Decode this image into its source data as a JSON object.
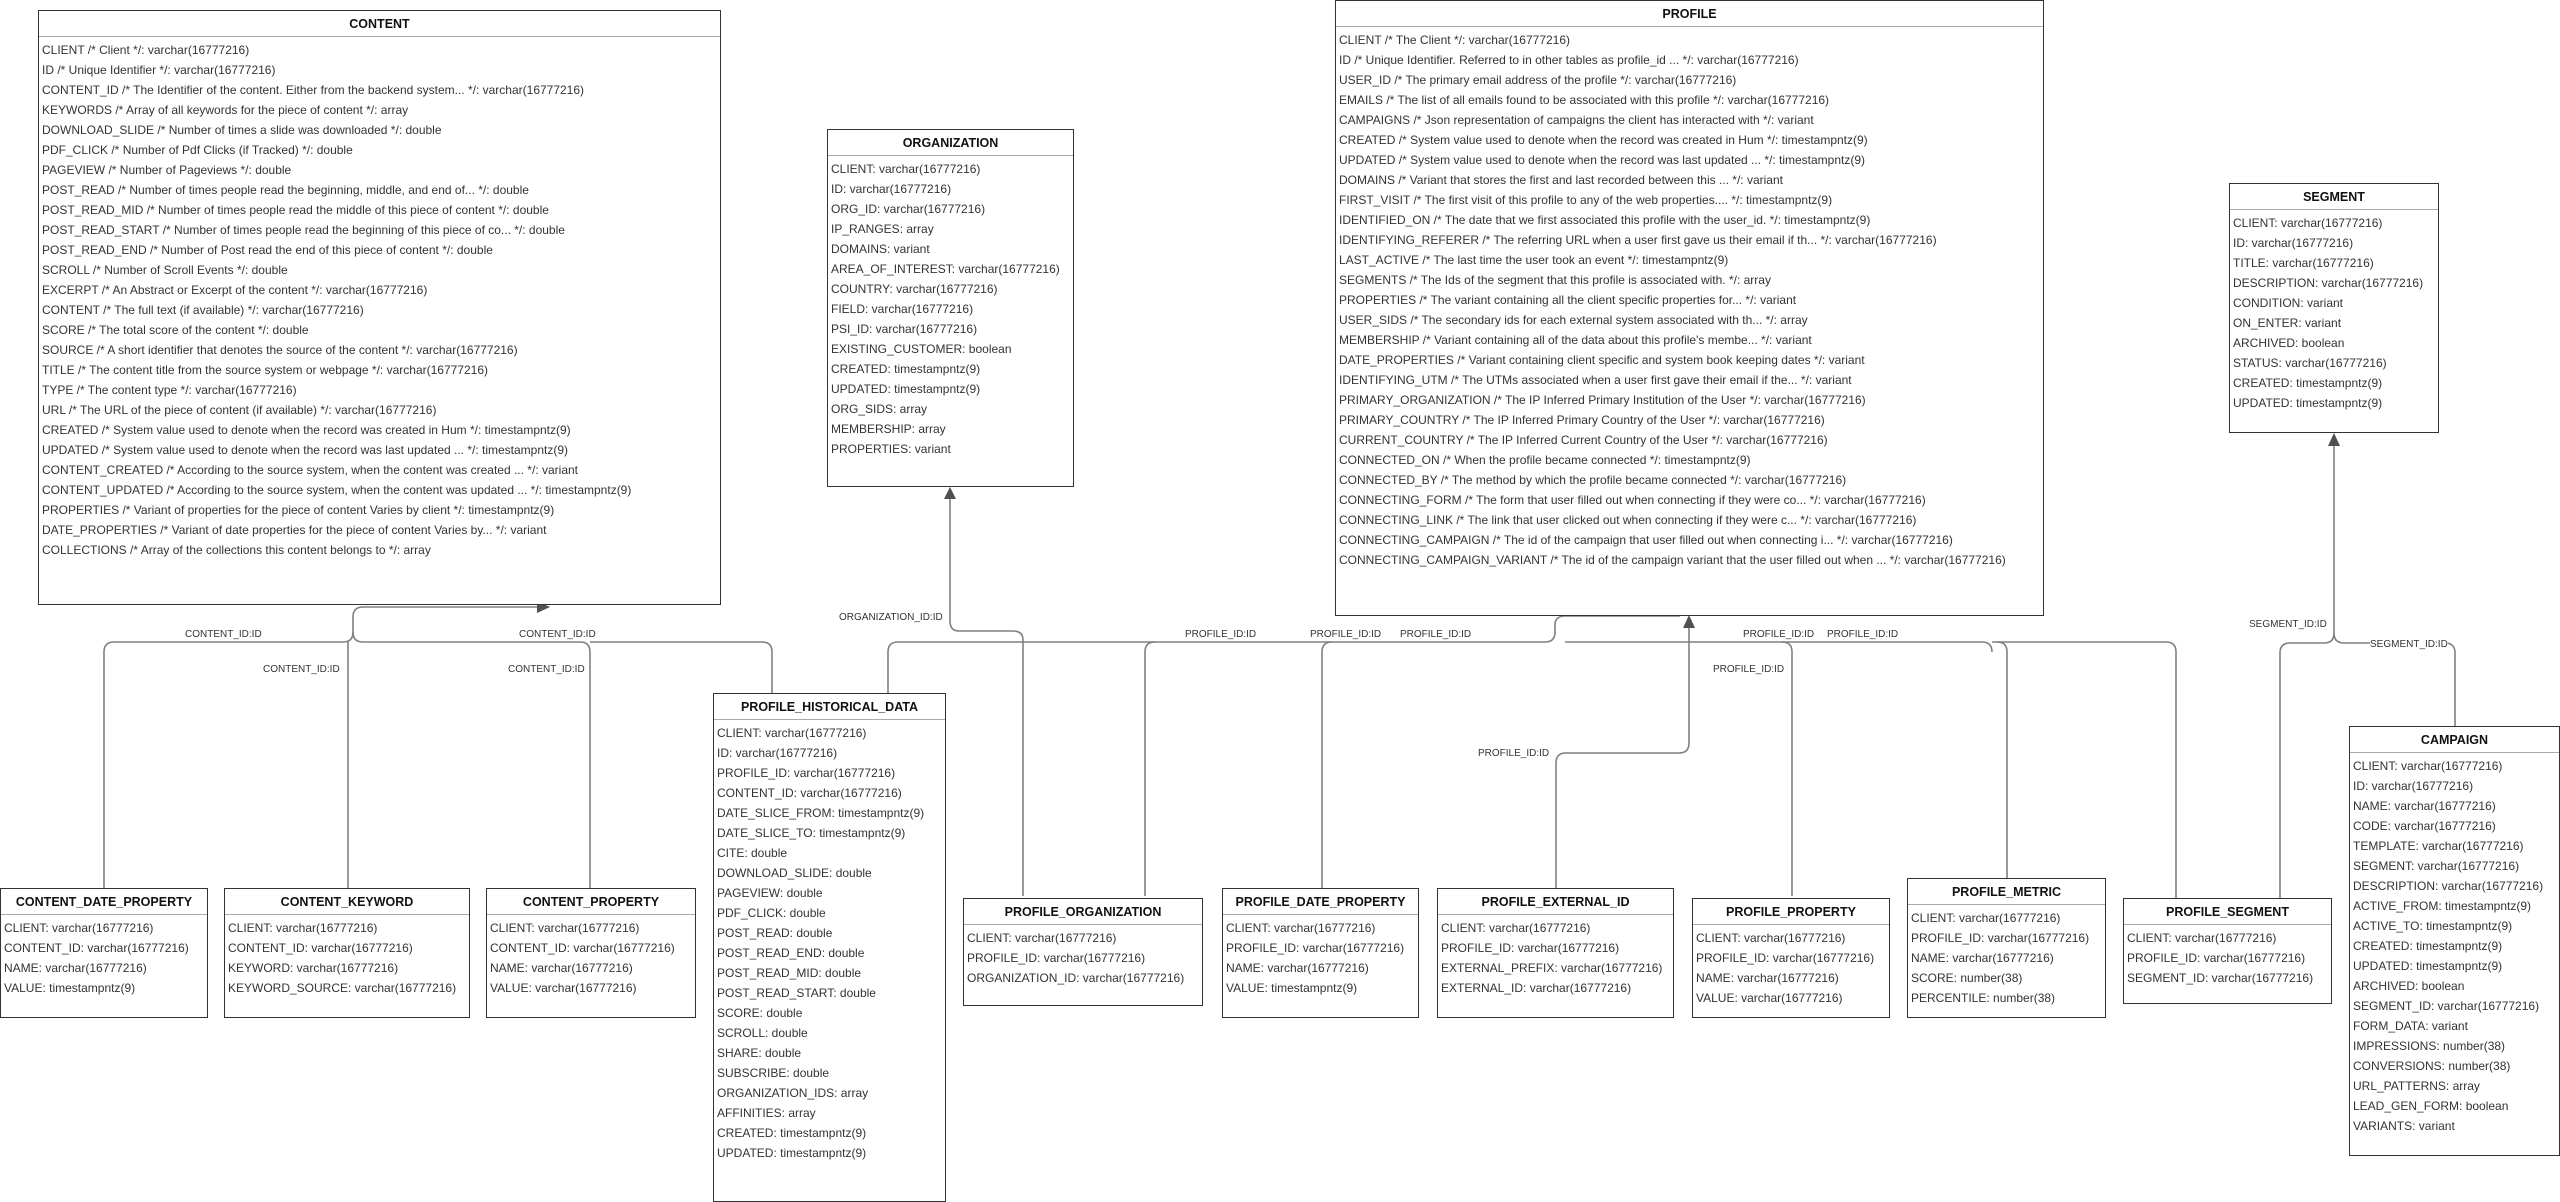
{
  "diagram": {
    "entities": {
      "content": {
        "title": "CONTENT",
        "fields": [
          "CLIENT /* Client */: varchar(16777216)",
          "ID /* Unique Identifier */: varchar(16777216)",
          "CONTENT_ID /* The Identifier of the content. Either from the backend system... */: varchar(16777216)",
          "KEYWORDS /* Array of all keywords for the piece of content */: array",
          "DOWNLOAD_SLIDE /* Number of times a slide was downloaded */: double",
          "PDF_CLICK /* Number of Pdf Clicks (if Tracked) */: double",
          "PAGEVIEW /* Number of Pageviews */: double",
          "POST_READ /* Number of times people read the beginning, middle, and end of... */: double",
          "POST_READ_MID /* Number of times people read the middle of this piece of content */: double",
          "POST_READ_START /* Number of times people read the beginning of this piece of co... */: double",
          "POST_READ_END /* Number of Post read the end of this piece of content */: double",
          "SCROLL /* Number of Scroll Events */: double",
          "EXCERPT /* An Abstract or Excerpt of the content */: varchar(16777216)",
          "CONTENT /* The full text (if available) */: varchar(16777216)",
          "SCORE /* The total score of the content */: double",
          "SOURCE /* A short identifier that denotes the source of the content */: varchar(16777216)",
          "TITLE /* The content title from the source system or webpage */: varchar(16777216)",
          "TYPE /* The content type */: varchar(16777216)",
          "URL /* The URL of the piece of content (if available) */: varchar(16777216)",
          "CREATED /* System value used to denote when the record was created in Hum */: timestampntz(9)",
          "UPDATED /* System value used to denote when the record was last updated ... */: timestampntz(9)",
          "CONTENT_CREATED /* According to the source system, when the content was created ... */: variant",
          "CONTENT_UPDATED /* According to the source system, when the content was updated ... */: timestampntz(9)",
          "PROPERTIES /* Variant of properties for the piece of content Varies by client */: timestampntz(9)",
          "DATE_PROPERTIES /* Variant of date properties for the piece of content Varies by... */: variant",
          "COLLECTIONS /* Array of the collections this content belongs to */: array"
        ]
      },
      "organization": {
        "title": "ORGANIZATION",
        "fields": [
          "CLIENT: varchar(16777216)",
          "ID: varchar(16777216)",
          "ORG_ID: varchar(16777216)",
          "IP_RANGES: array",
          "DOMAINS: variant",
          "AREA_OF_INTEREST: varchar(16777216)",
          "COUNTRY: varchar(16777216)",
          "FIELD: varchar(16777216)",
          "PSI_ID: varchar(16777216)",
          "EXISTING_CUSTOMER: boolean",
          "CREATED: timestampntz(9)",
          "UPDATED: timestampntz(9)",
          "ORG_SIDS: array",
          "MEMBERSHIP: array",
          "PROPERTIES: variant"
        ]
      },
      "profile": {
        "title": "PROFILE",
        "fields": [
          "CLIENT /* The Client */: varchar(16777216)",
          "ID /* Unique Identifier. Referred to in other tables as profile_id ... */: varchar(16777216)",
          "USER_ID /* The primary email address of the profile */: varchar(16777216)",
          "EMAILS /* The list of all emails found to be associated with this profile */: varchar(16777216)",
          "CAMPAIGNS /* Json representation of campaigns the client has interacted with */: variant",
          "CREATED /* System value used to denote when the record was created in Hum */: timestampntz(9)",
          "UPDATED /* System value used to denote when the record was last updated ... */: timestampntz(9)",
          "DOMAINS /* Variant that stores the first and last recorded between this ... */: variant",
          "FIRST_VISIT /* The first visit of this profile to any of the web properties.... */: timestampntz(9)",
          "IDENTIFIED_ON /* The date that we first associated this profile with the user_id. */: timestampntz(9)",
          "IDENTIFYING_REFERER /* The referring URL when a user first gave us their email if th... */: varchar(16777216)",
          "LAST_ACTIVE /* The last time the user took an event */: timestampntz(9)",
          "SEGMENTS /* The Ids of the segment that this profile is associated with. */: array",
          "PROPERTIES /* The variant containing all the client specific properties for... */: variant",
          "USER_SIDS /* The secondary ids for each external system associated with th... */: array",
          "MEMBERSHIP /* Variant containing all of the data about this profile's membe... */: variant",
          "DATE_PROPERTIES /* Variant containing client specific and system book keeping dates */: variant",
          "IDENTIFYING_UTM /* The UTMs associated when a user first gave their email if the... */: variant",
          "PRIMARY_ORGANIZATION /* The IP Inferred Primary Institution of the User */: varchar(16777216)",
          "PRIMARY_COUNTRY /* The IP Inferred Primary Country of the User */: varchar(16777216)",
          "CURRENT_COUNTRY /* The IP Inferred Current Country of the User */: varchar(16777216)",
          "CONNECTED_ON /* When the profile became connected */: timestampntz(9)",
          "CONNECTED_BY /* The method by which the profile became connected */: varchar(16777216)",
          "CONNECTING_FORM /* The form that user filled out when connecting if they were co... */: varchar(16777216)",
          "CONNECTING_LINK /* The link that user clicked out when connecting if they were c... */: varchar(16777216)",
          "CONNECTING_CAMPAIGN /* The id of the campaign that user filled out when connecting i... */: varchar(16777216)",
          "CONNECTING_CAMPAIGN_VARIANT /* The id of the campaign variant that the user filled out when ... */: varchar(16777216)"
        ]
      },
      "segment": {
        "title": "SEGMENT",
        "fields": [
          "CLIENT: varchar(16777216)",
          "ID: varchar(16777216)",
          "TITLE: varchar(16777216)",
          "DESCRIPTION: varchar(16777216)",
          "CONDITION: variant",
          "ON_ENTER: variant",
          "ARCHIVED: boolean",
          "STATUS: varchar(16777216)",
          "CREATED: timestampntz(9)",
          "UPDATED: timestampntz(9)"
        ]
      },
      "profile_historical_data": {
        "title": "PROFILE_HISTORICAL_DATA",
        "fields": [
          "CLIENT: varchar(16777216)",
          "ID: varchar(16777216)",
          "PROFILE_ID: varchar(16777216)",
          "CONTENT_ID: varchar(16777216)",
          "DATE_SLICE_FROM: timestampntz(9)",
          "DATE_SLICE_TO: timestampntz(9)",
          "CITE: double",
          "DOWNLOAD_SLIDE: double",
          "PAGEVIEW: double",
          "PDF_CLICK: double",
          "POST_READ: double",
          "POST_READ_END: double",
          "POST_READ_MID: double",
          "POST_READ_START: double",
          "SCORE: double",
          "SCROLL: double",
          "SHARE: double",
          "SUBSCRIBE: double",
          "ORGANIZATION_IDS: array",
          "AFFINITIES: array",
          "CREATED: timestampntz(9)",
          "UPDATED: timestampntz(9)"
        ]
      },
      "content_date_property": {
        "title": "CONTENT_DATE_PROPERTY",
        "fields": [
          "CLIENT: varchar(16777216)",
          "CONTENT_ID: varchar(16777216)",
          "NAME: varchar(16777216)",
          "VALUE: timestampntz(9)"
        ]
      },
      "content_keyword": {
        "title": "CONTENT_KEYWORD",
        "fields": [
          "CLIENT: varchar(16777216)",
          "CONTENT_ID: varchar(16777216)",
          "KEYWORD: varchar(16777216)",
          "KEYWORD_SOURCE: varchar(16777216)"
        ]
      },
      "content_property": {
        "title": "CONTENT_PROPERTY",
        "fields": [
          "CLIENT: varchar(16777216)",
          "CONTENT_ID: varchar(16777216)",
          "NAME: varchar(16777216)",
          "VALUE: varchar(16777216)"
        ]
      },
      "profile_organization": {
        "title": "PROFILE_ORGANIZATION",
        "fields": [
          "CLIENT: varchar(16777216)",
          "PROFILE_ID: varchar(16777216)",
          "ORGANIZATION_ID: varchar(16777216)"
        ]
      },
      "profile_date_property": {
        "title": "PROFILE_DATE_PROPERTY",
        "fields": [
          "CLIENT: varchar(16777216)",
          "PROFILE_ID: varchar(16777216)",
          "NAME: varchar(16777216)",
          "VALUE: timestampntz(9)"
        ]
      },
      "profile_external_id": {
        "title": "PROFILE_EXTERNAL_ID",
        "fields": [
          "CLIENT: varchar(16777216)",
          "PROFILE_ID: varchar(16777216)",
          "EXTERNAL_PREFIX: varchar(16777216)",
          "EXTERNAL_ID: varchar(16777216)"
        ]
      },
      "profile_property": {
        "title": "PROFILE_PROPERTY",
        "fields": [
          "CLIENT: varchar(16777216)",
          "PROFILE_ID: varchar(16777216)",
          "NAME: varchar(16777216)",
          "VALUE: varchar(16777216)"
        ]
      },
      "profile_metric": {
        "title": "PROFILE_METRIC",
        "fields": [
          "CLIENT: varchar(16777216)",
          "PROFILE_ID: varchar(16777216)",
          "NAME: varchar(16777216)",
          "SCORE: number(38)",
          "PERCENTILE: number(38)"
        ]
      },
      "profile_segment": {
        "title": "PROFILE_SEGMENT",
        "fields": [
          "CLIENT: varchar(16777216)",
          "PROFILE_ID: varchar(16777216)",
          "SEGMENT_ID: varchar(16777216)"
        ]
      },
      "campaign": {
        "title": "CAMPAIGN",
        "fields": [
          "CLIENT: varchar(16777216)",
          "ID: varchar(16777216)",
          "NAME: varchar(16777216)",
          "CODE: varchar(16777216)",
          "TEMPLATE: varchar(16777216)",
          "SEGMENT: varchar(16777216)",
          "DESCRIPTION: varchar(16777216)",
          "ACTIVE_FROM: timestampntz(9)",
          "ACTIVE_TO: timestampntz(9)",
          "CREATED: timestampntz(9)",
          "UPDATED: timestampntz(9)",
          "ARCHIVED: boolean",
          "SEGMENT_ID: varchar(16777216)",
          "FORM_DATA: variant",
          "IMPRESSIONS: number(38)",
          "CONVERSIONS: number(38)",
          "URL_PATTERNS: array",
          "LEAD_GEN_FORM: boolean",
          "VARIANTS: variant"
        ]
      }
    },
    "relationships": [
      {
        "from": "CONTENT_DATE_PROPERTY",
        "to": "CONTENT",
        "label": "CONTENT_ID:ID"
      },
      {
        "from": "CONTENT_KEYWORD",
        "to": "CONTENT",
        "label": "CONTENT_ID:ID"
      },
      {
        "from": "CONTENT_PROPERTY",
        "to": "CONTENT",
        "label": "CONTENT_ID:ID"
      },
      {
        "from": "PROFILE_HISTORICAL_DATA",
        "to": "CONTENT",
        "label": "CONTENT_ID:ID"
      },
      {
        "from": "PROFILE_ORGANIZATION",
        "to": "ORGANIZATION",
        "label": "ORGANIZATION_ID:ID"
      },
      {
        "from": "PROFILE_HISTORICAL_DATA",
        "to": "PROFILE",
        "label": "PROFILE_ID:ID"
      },
      {
        "from": "PROFILE_ORGANIZATION",
        "to": "PROFILE",
        "label": "PROFILE_ID:ID"
      },
      {
        "from": "PROFILE_DATE_PROPERTY",
        "to": "PROFILE",
        "label": "PROFILE_ID:ID"
      },
      {
        "from": "PROFILE_EXTERNAL_ID",
        "to": "PROFILE",
        "label": "PROFILE_ID:ID"
      },
      {
        "from": "PROFILE_PROPERTY",
        "to": "PROFILE",
        "label": "PROFILE_ID:ID"
      },
      {
        "from": "PROFILE_METRIC",
        "to": "PROFILE",
        "label": "PROFILE_ID:ID"
      },
      {
        "from": "PROFILE_SEGMENT",
        "to": "PROFILE",
        "label": "PROFILE_ID:ID"
      },
      {
        "from": "PROFILE_SEGMENT",
        "to": "SEGMENT",
        "label": "SEGMENT_ID:ID"
      },
      {
        "from": "CAMPAIGN",
        "to": "SEGMENT",
        "label": "SEGMENT_ID:ID"
      }
    ],
    "labels": {
      "content_id": "CONTENT_ID:ID",
      "organization_id": "ORGANIZATION_ID:ID",
      "profile_id": "PROFILE_ID:ID",
      "segment_id": "SEGMENT_ID:ID"
    }
  }
}
